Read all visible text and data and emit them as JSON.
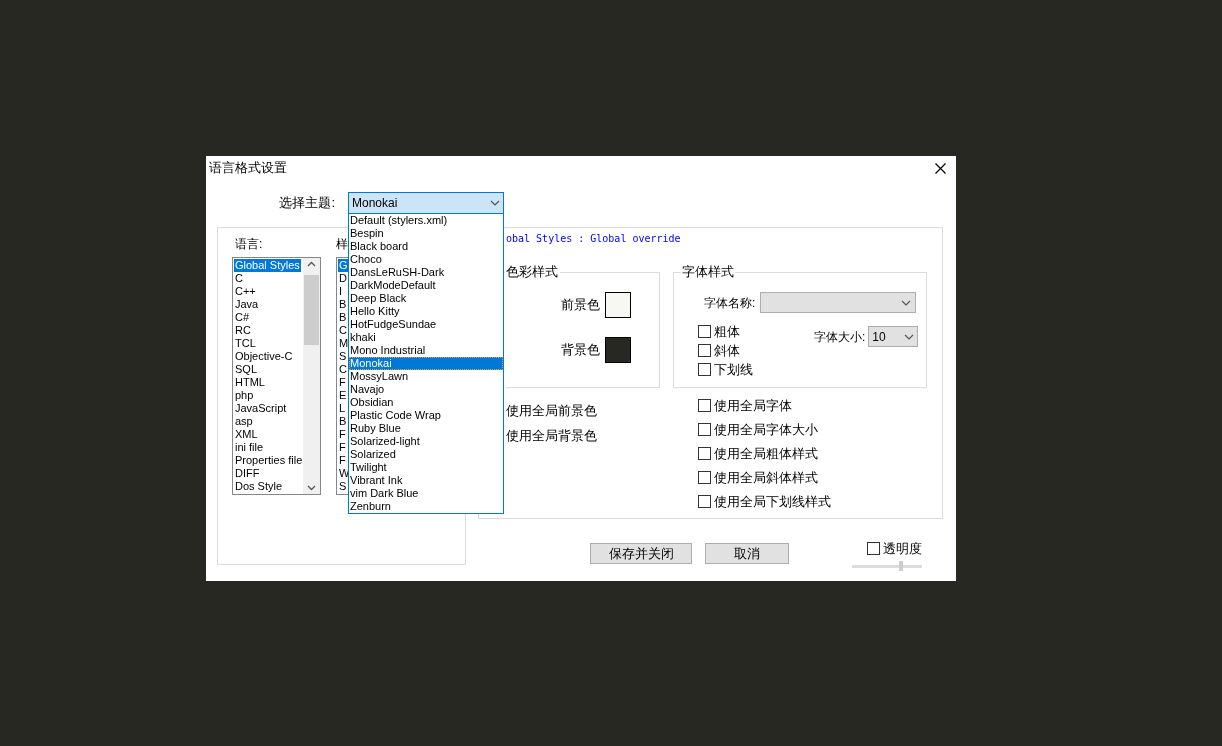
{
  "window": {
    "title": "语言格式设置"
  },
  "theme": {
    "label": "选择主题:",
    "value": "Monokai",
    "expanded": true,
    "options": [
      {
        "label": "Default (stylers.xml)",
        "selected": false
      },
      {
        "label": "Bespin",
        "selected": false
      },
      {
        "label": "Black board",
        "selected": false
      },
      {
        "label": "Choco",
        "selected": false
      },
      {
        "label": "DansLeRuSH-Dark",
        "selected": false
      },
      {
        "label": "DarkModeDefault",
        "selected": false
      },
      {
        "label": "Deep Black",
        "selected": false
      },
      {
        "label": "Hello Kitty",
        "selected": false
      },
      {
        "label": "HotFudgeSundae",
        "selected": false
      },
      {
        "label": "khaki",
        "selected": false
      },
      {
        "label": "Mono Industrial",
        "selected": false
      },
      {
        "label": "Monokai",
        "selected": true
      },
      {
        "label": "MossyLawn",
        "selected": false
      },
      {
        "label": "Navajo",
        "selected": false
      },
      {
        "label": "Obsidian",
        "selected": false
      },
      {
        "label": "Plastic Code Wrap",
        "selected": false
      },
      {
        "label": "Ruby Blue",
        "selected": false
      },
      {
        "label": "Solarized-light",
        "selected": false
      },
      {
        "label": "Solarized",
        "selected": false
      },
      {
        "label": "Twilight",
        "selected": false
      },
      {
        "label": "Vibrant Ink",
        "selected": false
      },
      {
        "label": "vim Dark Blue",
        "selected": false
      },
      {
        "label": "Zenburn",
        "selected": false
      }
    ]
  },
  "languages": {
    "label": "语言:",
    "items": [
      {
        "label": "Global Styles",
        "selected": true
      },
      {
        "label": "C",
        "selected": false
      },
      {
        "label": "C++",
        "selected": false
      },
      {
        "label": "Java",
        "selected": false
      },
      {
        "label": "C#",
        "selected": false
      },
      {
        "label": "RC",
        "selected": false
      },
      {
        "label": "TCL",
        "selected": false
      },
      {
        "label": "Objective-C",
        "selected": false
      },
      {
        "label": "SQL",
        "selected": false
      },
      {
        "label": "HTML",
        "selected": false
      },
      {
        "label": "php",
        "selected": false
      },
      {
        "label": "JavaScript",
        "selected": false
      },
      {
        "label": "asp",
        "selected": false
      },
      {
        "label": "XML",
        "selected": false
      },
      {
        "label": "ini file",
        "selected": false
      },
      {
        "label": "Properties file",
        "selected": false
      },
      {
        "label": "DIFF",
        "selected": false
      },
      {
        "label": "Dos Style",
        "selected": false
      }
    ]
  },
  "styles": {
    "label": "样",
    "items": [
      {
        "label": "G",
        "selected": true
      },
      {
        "label": "D",
        "selected": false
      },
      {
        "label": "I",
        "selected": false
      },
      {
        "label": "B",
        "selected": false
      },
      {
        "label": "B",
        "selected": false
      },
      {
        "label": "C",
        "selected": false
      },
      {
        "label": "M",
        "selected": false
      },
      {
        "label": "S",
        "selected": false
      },
      {
        "label": "C",
        "selected": false
      },
      {
        "label": "F",
        "selected": false
      },
      {
        "label": "E",
        "selected": false
      },
      {
        "label": "L",
        "selected": false
      },
      {
        "label": "B",
        "selected": false
      },
      {
        "label": "F",
        "selected": false
      },
      {
        "label": "F",
        "selected": false
      },
      {
        "label": "F",
        "selected": false
      },
      {
        "label": "W",
        "selected": false
      },
      {
        "label": "S",
        "selected": false
      }
    ]
  },
  "style_header": "obal Styles : Global override",
  "color_group": {
    "title": "色彩样式",
    "foreground": {
      "label": "前景色",
      "color": "#f8f8f2"
    },
    "background": {
      "label": "背景色",
      "color": "#272822"
    }
  },
  "font_group": {
    "title": "字体样式",
    "font_name": {
      "label": "字体名称:",
      "disabled": true
    },
    "options": [
      {
        "label": "粗体",
        "checked": false
      },
      {
        "label": "斜体",
        "checked": false
      },
      {
        "label": "下划线",
        "checked": false
      }
    ],
    "font_size": {
      "label": "字体大小:",
      "value": "10"
    }
  },
  "global_color_options": [
    "使用全局前景色",
    "使用全局背景色"
  ],
  "global_font_options": [
    {
      "label": "使用全局字体",
      "checked": false
    },
    {
      "label": "使用全局字体大小",
      "checked": false
    },
    {
      "label": "使用全局粗体样式",
      "checked": false
    },
    {
      "label": "使用全局斜体样式",
      "checked": false
    },
    {
      "label": "使用全局下划线样式",
      "checked": false
    }
  ],
  "buttons": [
    "保存并关闭",
    "取消"
  ],
  "transparency": {
    "label": "透明度",
    "checked": false,
    "level": 0.7
  }
}
